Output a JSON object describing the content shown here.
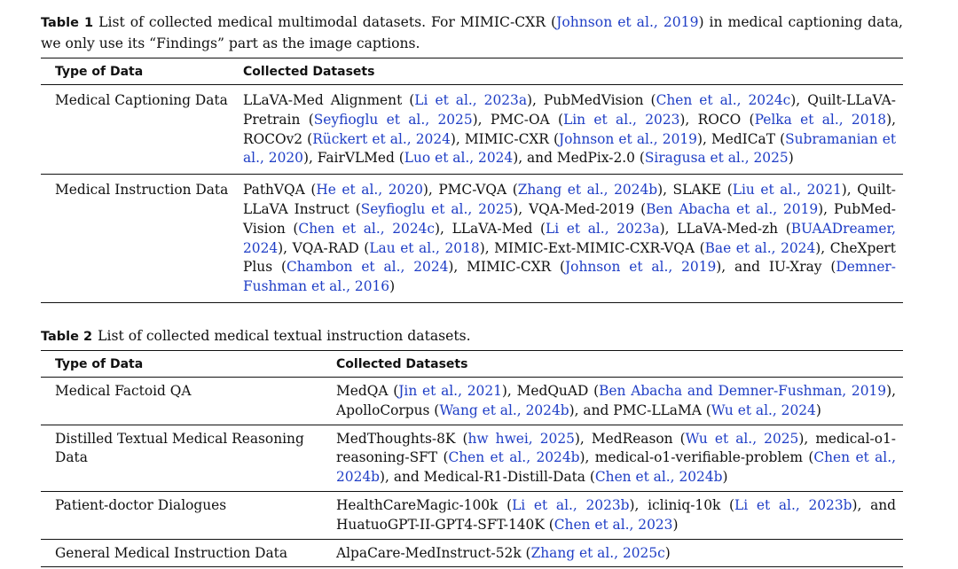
{
  "table1": {
    "label": "Table 1",
    "caption": [
      {
        "t": "List of collected medical multimodal datasets. For MIMIC-CXR ("
      },
      {
        "t": "Johnson et al., 2019",
        "c": true
      },
      {
        "t": ") in medical captioning data, we only use its “Findings” part as the image captions."
      }
    ],
    "headers": [
      "Type of Data",
      "Collected Datasets"
    ],
    "rows": [
      {
        "type": "Medical Captioning Data",
        "datasets": [
          {
            "t": "LLaVA-Med Alignment ("
          },
          {
            "t": "Li et al., 2023a",
            "c": true
          },
          {
            "t": "), PubMedVision ("
          },
          {
            "t": "Chen et al., 2024c",
            "c": true
          },
          {
            "t": "), Quilt-LLaVA-Pretrain ("
          },
          {
            "t": "Seyfioglu et al., 2025",
            "c": true
          },
          {
            "t": "), PMC-OA ("
          },
          {
            "t": "Lin et al., 2023",
            "c": true
          },
          {
            "t": "), ROCO ("
          },
          {
            "t": "Pelka et al., 2018",
            "c": true
          },
          {
            "t": "), ROCOv2 ("
          },
          {
            "t": "Rückert et al., 2024",
            "c": true
          },
          {
            "t": "), MIMIC-CXR ("
          },
          {
            "t": "Johnson et al., 2019",
            "c": true
          },
          {
            "t": "), MedICaT ("
          },
          {
            "t": "Subramanian et al., 2020",
            "c": true
          },
          {
            "t": "), FairVLMed ("
          },
          {
            "t": "Luo et al., 2024",
            "c": true
          },
          {
            "t": "), and MedPix-2.0 ("
          },
          {
            "t": "Siragusa et al., 2025",
            "c": true
          },
          {
            "t": ")"
          }
        ]
      },
      {
        "type": "Medical Instruction Data",
        "datasets": [
          {
            "t": "PathVQA ("
          },
          {
            "t": "He et al., 2020",
            "c": true
          },
          {
            "t": "), PMC-VQA ("
          },
          {
            "t": "Zhang et al., 2024b",
            "c": true
          },
          {
            "t": "), SLAKE ("
          },
          {
            "t": "Liu et al., 2021",
            "c": true
          },
          {
            "t": "), Quilt-LLaVA Instruct ("
          },
          {
            "t": "Seyfioglu et al., 2025",
            "c": true
          },
          {
            "t": "), VQA-Med-2019 ("
          },
          {
            "t": "Ben Abacha et al., 2019",
            "c": true
          },
          {
            "t": "), PubMed-Vision ("
          },
          {
            "t": "Chen et al., 2024c",
            "c": true
          },
          {
            "t": "), LLaVA-Med ("
          },
          {
            "t": "Li et al., 2023a",
            "c": true
          },
          {
            "t": "), LLaVA-Med-zh ("
          },
          {
            "t": "BUAADreamer, 2024",
            "c": true
          },
          {
            "t": "), VQA-RAD ("
          },
          {
            "t": "Lau et al., 2018",
            "c": true
          },
          {
            "t": "), MIMIC-Ext-MIMIC-CXR-VQA ("
          },
          {
            "t": "Bae et al., 2024",
            "c": true
          },
          {
            "t": "), CheXpert Plus ("
          },
          {
            "t": "Chambon et al., 2024",
            "c": true
          },
          {
            "t": "), MIMIC-CXR ("
          },
          {
            "t": "Johnson et al., 2019",
            "c": true
          },
          {
            "t": "), and IU-Xray ("
          },
          {
            "t": "Demner-Fushman et al., 2016",
            "c": true
          },
          {
            "t": ")"
          }
        ]
      }
    ]
  },
  "table2": {
    "label": "Table 2",
    "caption": [
      {
        "t": "List of collected medical textual instruction datasets."
      }
    ],
    "headers": [
      "Type of Data",
      "Collected Datasets"
    ],
    "rows": [
      {
        "type": "Medical Factoid QA",
        "datasets": [
          {
            "t": "MedQA ("
          },
          {
            "t": "Jin et al., 2021",
            "c": true
          },
          {
            "t": "), MedQuAD ("
          },
          {
            "t": "Ben Abacha and Demner-Fushman, 2019",
            "c": true
          },
          {
            "t": "), ApolloCorpus ("
          },
          {
            "t": "Wang et al., 2024b",
            "c": true
          },
          {
            "t": "), and PMC-LLaMA ("
          },
          {
            "t": "Wu et al., 2024",
            "c": true
          },
          {
            "t": ")"
          }
        ]
      },
      {
        "type": "Distilled Textual Medical Reasoning Data",
        "datasets": [
          {
            "t": "MedThoughts-8K ("
          },
          {
            "t": "hw hwei, 2025",
            "c": true
          },
          {
            "t": "), MedReason ("
          },
          {
            "t": "Wu et al., 2025",
            "c": true
          },
          {
            "t": "), medical-o1-reasoning-SFT ("
          },
          {
            "t": "Chen et al., 2024b",
            "c": true
          },
          {
            "t": "), medical-o1-verifiable-problem ("
          },
          {
            "t": "Chen et al., 2024b",
            "c": true
          },
          {
            "t": "), and Medical-R1-Distill-Data ("
          },
          {
            "t": "Chen et al., 2024b",
            "c": true
          },
          {
            "t": ")"
          }
        ]
      },
      {
        "type": "Patient-doctor Dialogues",
        "datasets": [
          {
            "t": "HealthCareMagic-100k ("
          },
          {
            "t": "Li et al., 2023b",
            "c": true
          },
          {
            "t": "), icliniq-10k ("
          },
          {
            "t": "Li et al., 2023b",
            "c": true
          },
          {
            "t": "), and HuatuoGPT-II-GPT4-SFT-140K ("
          },
          {
            "t": "Chen et al., 2023",
            "c": true
          },
          {
            "t": ")"
          }
        ]
      },
      {
        "type": "General Medical Instruction Data",
        "datasets": [
          {
            "t": "AlpaCare-MedInstruct-52k ("
          },
          {
            "t": "Zhang et al., 2025c",
            "c": true
          },
          {
            "t": ")"
          }
        ]
      }
    ]
  },
  "colors": {
    "citation": "#1f3ec6",
    "text": "#111111"
  }
}
